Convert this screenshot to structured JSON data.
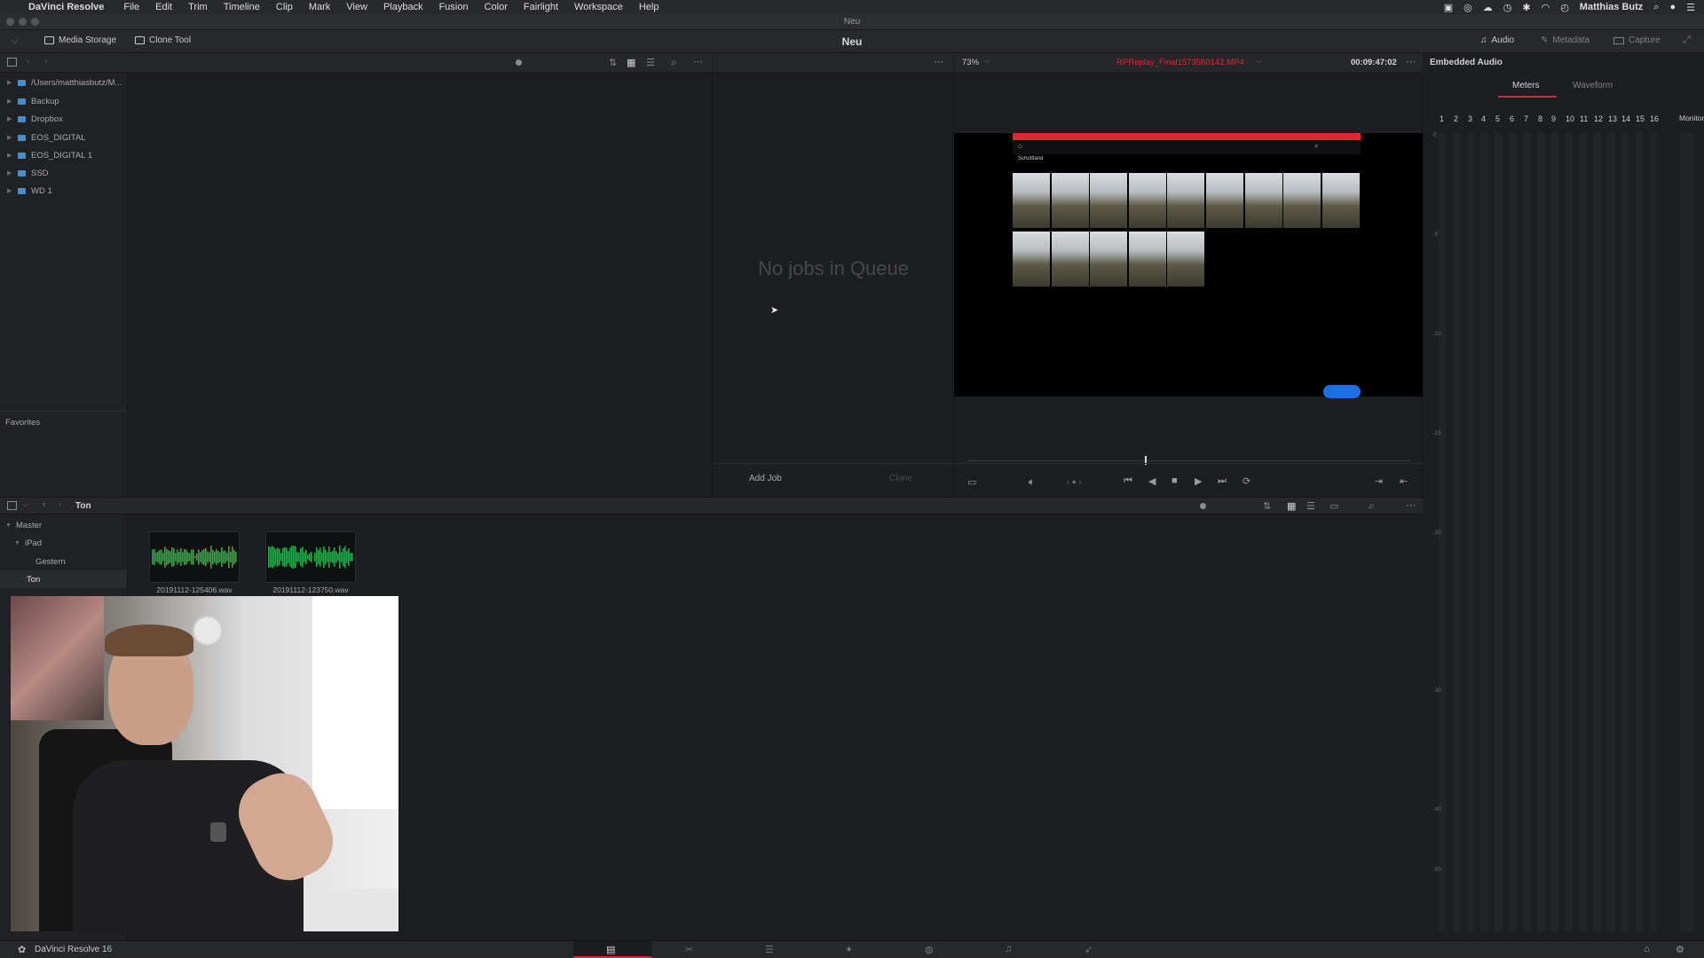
{
  "menubar": {
    "app_name": "DaVinci Resolve",
    "items": [
      "File",
      "Edit",
      "Trim",
      "Timeline",
      "Clip",
      "Mark",
      "View",
      "Playback",
      "Fusion",
      "Color",
      "Fairlight",
      "Workspace",
      "Help"
    ],
    "user": "Matthias Butz"
  },
  "window": {
    "title": "Neu"
  },
  "toolbar": {
    "media_storage": "Media Storage",
    "clone_tool": "Clone Tool",
    "project_title": "Neu",
    "audio": "Audio",
    "metadata": "Metadata",
    "capture": "Capture"
  },
  "media_storage": {
    "locations": [
      "/Users/matthiasbutz/M...",
      "Backup",
      "Dropbox",
      "EOS_DIGITAL",
      "EOS_DIGITAL 1",
      "SSD",
      "WD 1"
    ],
    "favorites_label": "Favorites"
  },
  "clone": {
    "empty_message": "No jobs in Queue",
    "add_job": "Add Job",
    "clone_button": "Clone"
  },
  "viewer": {
    "zoom": "73%",
    "clip_name": "RPReplay_Final1573560142.MP4",
    "timecode": "00:09:47:02",
    "inner_title": "Schottland"
  },
  "audio_panel": {
    "title": "Embedded Audio",
    "tabs": [
      "Meters",
      "Waveform"
    ],
    "channels": [
      "1",
      "2",
      "3",
      "4",
      "5",
      "6",
      "7",
      "8",
      "9",
      "10",
      "11",
      "12",
      "13",
      "14",
      "15",
      "16"
    ],
    "monitor": "Monitor",
    "scale": [
      "0",
      "-5",
      "-10",
      "-15",
      "-20",
      "-30",
      "-40",
      "-50"
    ]
  },
  "media_pool": {
    "current_bin": "Ton",
    "tree": [
      {
        "label": "Master",
        "depth": 0
      },
      {
        "label": "iPad",
        "depth": 1
      },
      {
        "label": "Gestern",
        "depth": 2
      },
      {
        "label": "Ton",
        "depth": 1
      }
    ],
    "clips": [
      "20191112-125406.wav",
      "20191112-123750.wav"
    ]
  },
  "footer": {
    "app_label": "DaVinci Resolve 16"
  },
  "colors": {
    "accent_red": "#e0262f",
    "waveform_green": "#2fa84a",
    "tab_active_underline": "#c8323a"
  }
}
